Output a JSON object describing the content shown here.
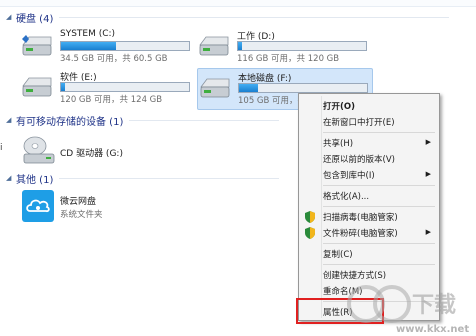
{
  "groups": {
    "hard_disks": "硬盘 (4)",
    "removable": "有可移动存储的设备 (1)",
    "other": "其他 (1)"
  },
  "drives": [
    {
      "name": "SYSTEM (C:)",
      "info": "34.5 GB 可用，共 60.5 GB",
      "used": 0.43
    },
    {
      "name": "工作 (D:)",
      "info": "116 GB 可用，共 120 GB",
      "used": 0.03
    },
    {
      "name": "软件 (E:)",
      "info": "120 GB 可用，共 124 GB",
      "used": 0.03
    },
    {
      "name": "本地磁盘 (F:)",
      "info": "105 GB 可用，共 124 GB",
      "used": 0.15
    }
  ],
  "cd_drive": {
    "name": "CD 驱动器 (G:)"
  },
  "other_item": {
    "name": "微云网盘",
    "subtitle": "系统文件夹"
  },
  "left_edge_char": "i",
  "context_menu": {
    "open": "打开(O)",
    "open_new_window": "在新窗口中打开(E)",
    "share": "共享(H)",
    "restore": "还原以前的版本(V)",
    "include_library": "包含到库中(I)",
    "format": "格式化(A)...",
    "scan_virus": "扫描病毒(电脑管家)",
    "shred": "文件粉碎(电脑管家)",
    "copy": "复制(C)",
    "create_shortcut": "创建快捷方式(S)",
    "rename": "重命名(M)",
    "properties": "属性(R)"
  },
  "watermark": {
    "text": "KK下载",
    "url": "www.kkx.net"
  },
  "colors": {
    "accent": "#1e3287",
    "highlight_border": "#e02020",
    "bar_fill": "#2a8fe0"
  }
}
